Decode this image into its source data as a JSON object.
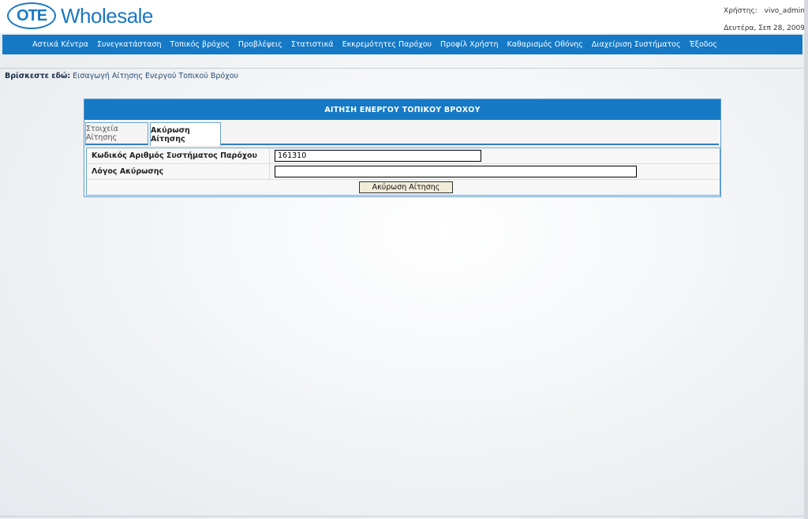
{
  "header": {
    "logo_mark": "OTE",
    "logo_text": "Wholesale",
    "user_label": "Χρήστης:",
    "username": "vivo_admin",
    "date": "Δευτέρα, Σεπ 28, 2009"
  },
  "nav": {
    "items": [
      "Αστικά Κέντρα",
      "Συνεγκατάσταση",
      "Τοπικός βρόχος",
      "Προβλέψεις",
      "Στατιστικά",
      "Εκκρεμότητες Παρόχου",
      "Προφίλ Χρήστη",
      "Καθαρισμός Οθόνης",
      "Διαχείριση Συστήματος",
      "Έξοδος"
    ]
  },
  "breadcrumb": {
    "label": "Βρίσκεστε εδώ:",
    "current": "Εισαγωγή Αίτησης Ενεργού Τοπικού Βρόχου"
  },
  "panel": {
    "title": "ΑΙΤΗΣΗ ΕΝΕΡΓΟΥ ΤΟΠΙΚΟΥ ΒΡΟΧΟΥ",
    "tabs": [
      {
        "label": "Στοιχεία Αίτησης",
        "active": false
      },
      {
        "label": "Ακύρωση Αίτησης",
        "active": true
      }
    ],
    "form": {
      "system_code_label": "Κωδικός Αριθμός Συστήματος Παρόχου",
      "system_code_value": "161310",
      "reason_label": "Λόγος Ακύρωσης",
      "reason_value": "",
      "submit_label": "Ακύρωση Αίτησης"
    }
  },
  "colors": {
    "brand_blue": "#1579c6",
    "button_bg": "#f1ecd8"
  }
}
